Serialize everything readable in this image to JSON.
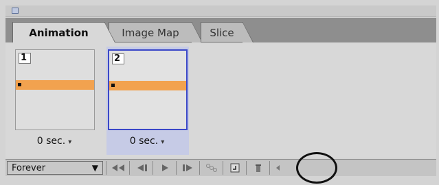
{
  "panel": {
    "tabs": [
      {
        "label": "Animation",
        "active": true
      },
      {
        "label": "Image Map",
        "active": false
      },
      {
        "label": "Slice",
        "active": false
      }
    ]
  },
  "frames": [
    {
      "number": "1",
      "delay": "0 sec.",
      "selected": false
    },
    {
      "number": "2",
      "delay": "0 sec.",
      "selected": true
    }
  ],
  "toolbar": {
    "loop_value": "Forever",
    "buttons": [
      "select-first-frame",
      "select-previous-frame",
      "play",
      "select-next-frame",
      "tween",
      "duplicate-frame",
      "delete-frame",
      "scroll-left"
    ]
  },
  "colors": {
    "frame_bar": "#f2a24f",
    "selected_frame_bg": "#c6cbe6",
    "selected_frame_border": "#3a47c8"
  }
}
